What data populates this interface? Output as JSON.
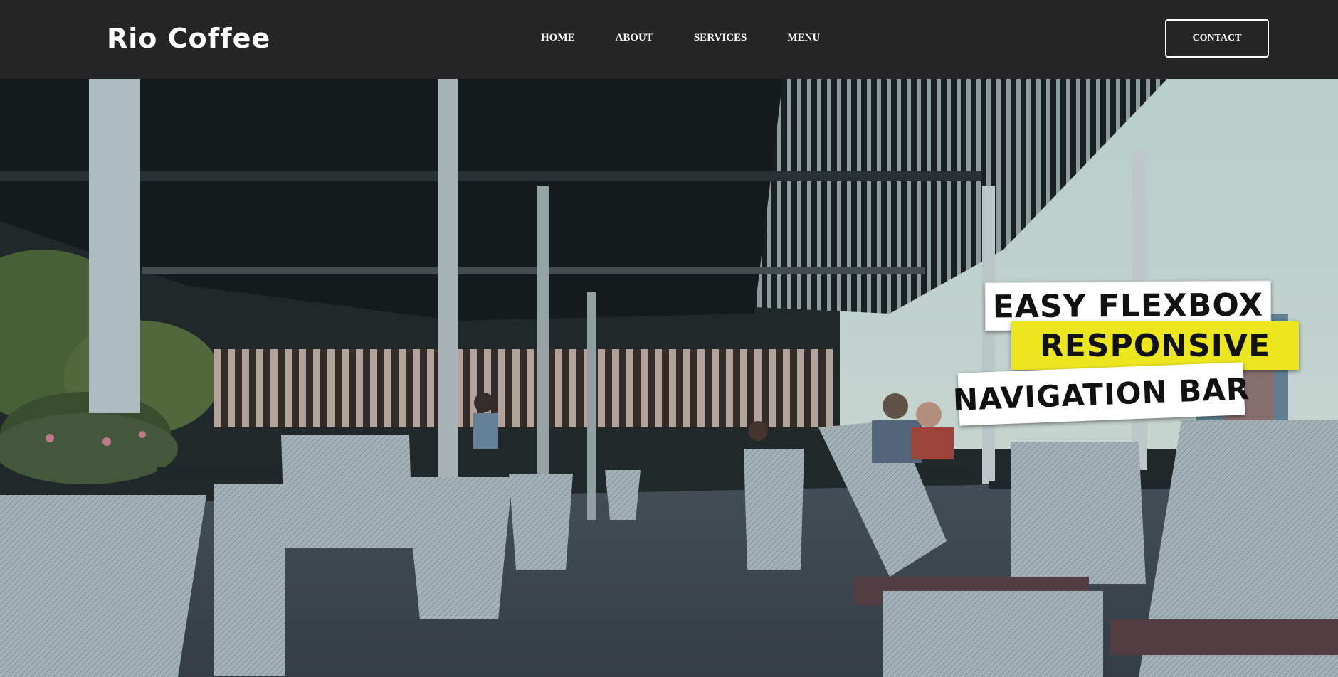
{
  "header": {
    "brand": "Rio Coffee",
    "nav": [
      "HOME",
      "ABOUT",
      "SERVICES",
      "MENU"
    ],
    "contact_label": "CONTACT"
  },
  "hero": {
    "image_description_icon": "cafe-terrace-photo",
    "taglines": [
      "EASY FLEXBOX",
      "RESPONSIVE",
      "NAVIGATION BAR"
    ]
  },
  "colors": {
    "navbar_bg": "#252525",
    "accent_yellow": "#ece61f",
    "text_light": "#ffffff"
  }
}
